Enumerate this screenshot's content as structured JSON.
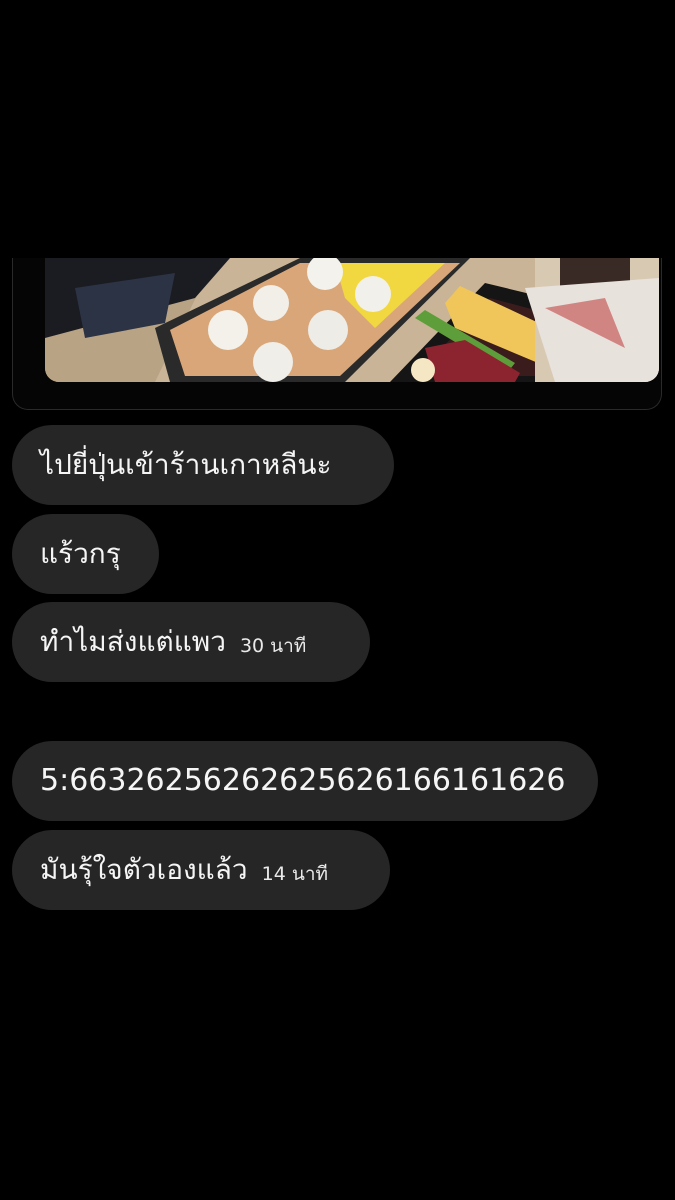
{
  "media": {
    "image_description_icon": "food-photo-icon"
  },
  "messages": [
    {
      "text": "ไปยี่ปุ่นเข้าร้านเกาหลีนะ",
      "time": ""
    },
    {
      "text": "แร้วกรุ",
      "time": ""
    },
    {
      "text": "ทำไมส่งแต่แพว",
      "time": "30 นาที"
    },
    {
      "text": "5:66326256262625626166161626",
      "time": ""
    },
    {
      "text": "มันรุ้ใจตัวเองแล้ว",
      "time": "14 นาที"
    }
  ],
  "colors": {
    "background": "#000000",
    "bubble": "#262626",
    "text": "#f5f5f5"
  }
}
